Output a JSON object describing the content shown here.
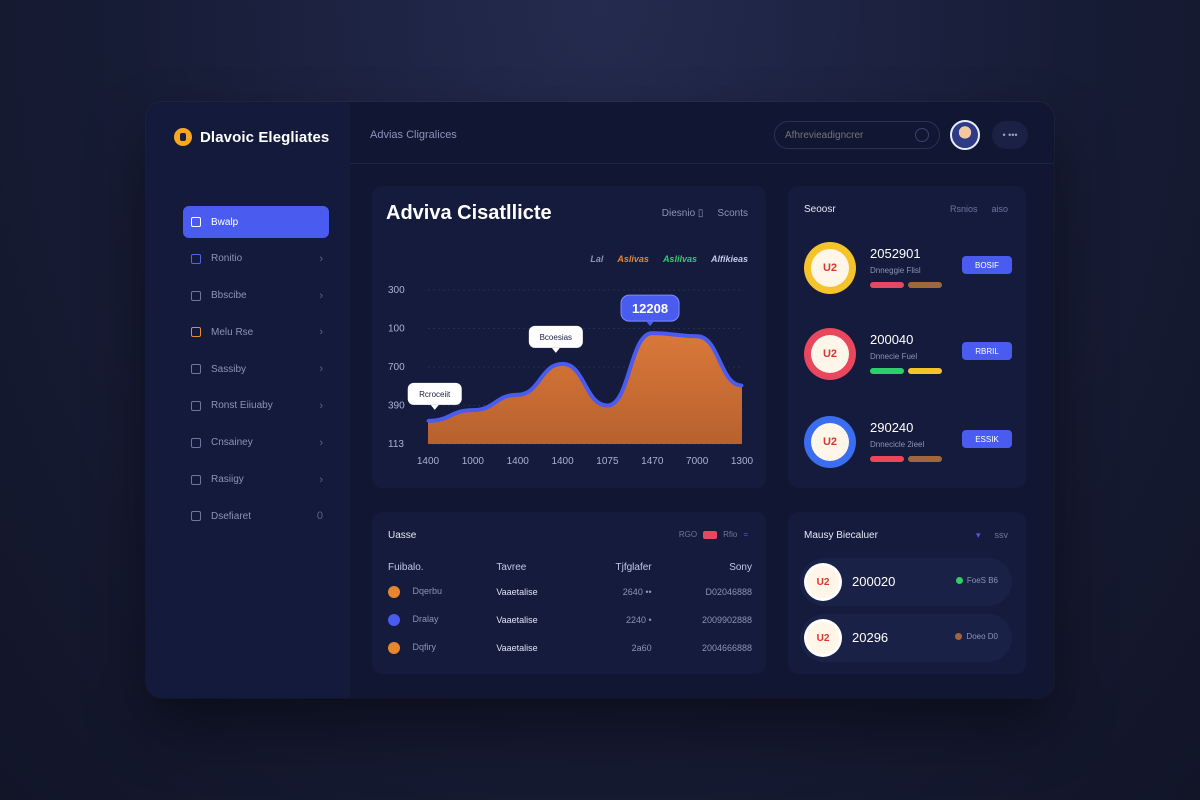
{
  "app": {
    "brand_name": "Dlavoic Elegliates",
    "breadcrumb": "Advias Cligralices"
  },
  "topbar": {
    "search_placeholder": "Afhrevieadigncrer",
    "user_label": "• •••"
  },
  "sidebar": {
    "items": [
      {
        "label": "Bwalp",
        "active": true,
        "icon": "list-icon"
      },
      {
        "label": "Ronitio",
        "active": false,
        "icon": "chart-icon"
      },
      {
        "label": "Bbscibe",
        "active": false,
        "icon": "card-icon"
      },
      {
        "label": "Melu Rse",
        "active": false,
        "icon": "folder-icon"
      },
      {
        "label": "Sassiby",
        "active": false,
        "icon": "lock-icon"
      },
      {
        "label": "Ronst Eiiuaby",
        "active": false,
        "icon": "cloud-icon"
      },
      {
        "label": "Cnsainey",
        "active": false,
        "icon": "box-icon"
      },
      {
        "label": "Rasiigy",
        "active": false,
        "icon": "wallet-icon"
      },
      {
        "label": "Dsefiaret",
        "active": false,
        "icon": "calendar-icon"
      }
    ]
  },
  "chart_panel": {
    "title": "Adviva Cisatllicte",
    "actions": [
      "Diesnio ▯",
      "Sconts"
    ],
    "legend": [
      {
        "label": "Lal",
        "color": "#8b93b8"
      },
      {
        "label": "Aslivas",
        "color": "#e8852f"
      },
      {
        "label": "Aslilvas",
        "color": "#2fce6a"
      },
      {
        "label": "Alfikieas",
        "color": "#c2c8e6"
      }
    ],
    "callouts": [
      "Rcroceiit",
      "Bcoesias",
      "12208"
    ]
  },
  "chart_data": {
    "type": "area",
    "x": [
      "1400",
      "1000",
      "1400",
      "1400",
      "1075",
      "1470",
      "7000",
      "1300"
    ],
    "yticks": [
      "300",
      "100",
      "700",
      "390",
      "113"
    ],
    "series": [
      {
        "values": [
          0.15,
          0.22,
          0.32,
          0.52,
          0.25,
          0.72,
          0.7,
          0.38
        ]
      }
    ],
    "grid": true,
    "colors": {
      "fill": "#d9783a",
      "line": "#4a5cf0"
    }
  },
  "right_top": {
    "title": "Seoosr",
    "actions": [
      "Rsnios",
      "aiso"
    ],
    "rows": [
      {
        "value": "2052901",
        "sub": "Dnneggie Flisl",
        "badge_text": "U2",
        "ring": "#f5c32a",
        "bar1": "#e8475e",
        "bar2": "#a0673a",
        "button": "BOSIF"
      },
      {
        "value": "200040",
        "sub": "Dnnecie Fuel",
        "badge_text": "U2",
        "ring": "#e8475e",
        "bar1": "#2fce6a",
        "bar2": "#f5c32a",
        "button": "RBRIL"
      },
      {
        "value": "290240",
        "sub": "Dnnecicle 2ieel",
        "badge_text": "U2",
        "ring": "#3a6df0",
        "bar1": "#e8475e",
        "bar2": "#a0673a",
        "button": "ESSIK"
      }
    ]
  },
  "table_panel": {
    "title": "Uasse",
    "tags": [
      "RGO",
      "Rfio"
    ],
    "columns": [
      "Fuibalo.",
      "Tavree",
      "Tjfglafer",
      "Sony"
    ],
    "rows": [
      {
        "c1": "Dqerbu",
        "c2": "Vaaetalise",
        "c3": "2640 ••",
        "c4": "D02046888",
        "dot": "#e8852f"
      },
      {
        "c1": "Dralay",
        "c2": "Vaaetalise",
        "c3": "2240 •",
        "c4": "2009902888",
        "dot": "#4a5cf0"
      },
      {
        "c1": "Dqfiry",
        "c2": "Vaaetalise",
        "c3": "2a60",
        "c4": "2004666888",
        "dot": "#e8852f"
      }
    ]
  },
  "right_bottom": {
    "title": "Mausy Biecaluer",
    "actions": [
      "▾",
      "ssv"
    ],
    "rows": [
      {
        "value": "200020",
        "badge_text": "U2",
        "status": "FoeS B6",
        "status_color": "#2fce6a"
      },
      {
        "value": "20296",
        "badge_text": "U2",
        "status": "Doeo D0",
        "status_color": "#a0673a"
      }
    ]
  }
}
